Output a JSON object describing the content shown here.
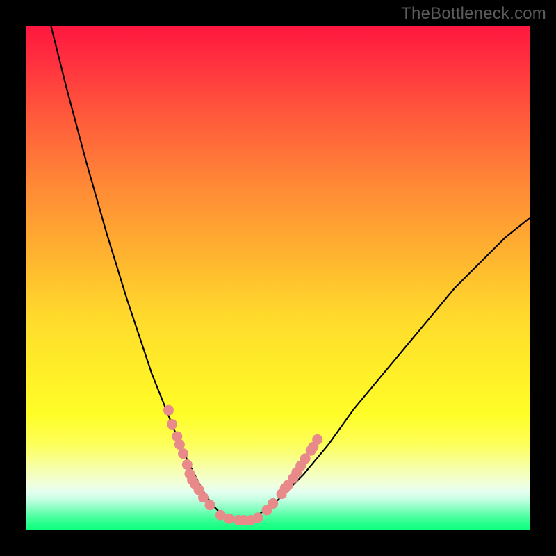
{
  "watermark": "TheBottleneck.com",
  "colors": {
    "background": "#000000",
    "curve_stroke": "#000000",
    "marker_fill": "#e88a8a",
    "gradient_top": "#ff173f",
    "gradient_bottom": "#0dff7c"
  },
  "chart_data": {
    "type": "line",
    "title": "",
    "xlabel": "",
    "ylabel": "",
    "xlim": [
      0,
      100
    ],
    "ylim": [
      0,
      100
    ],
    "series": [
      {
        "name": "bottleneck-curve",
        "x": [
          5,
          8,
          12,
          16,
          20,
          23,
          25,
          27,
          29,
          31,
          33,
          35,
          37,
          38.5,
          40,
          42,
          44,
          46,
          50,
          55,
          60,
          65,
          70,
          75,
          80,
          85,
          90,
          95,
          100
        ],
        "y": [
          100,
          88,
          73,
          59,
          46,
          37,
          31,
          26,
          21,
          16,
          12,
          8,
          5,
          3.5,
          2.5,
          2,
          2,
          3,
          6,
          11,
          17,
          24,
          30,
          36,
          42,
          48,
          53,
          58,
          62
        ]
      }
    ],
    "markers": [
      {
        "x": 28.3,
        "y": 23.8
      },
      {
        "x": 29.0,
        "y": 21.0
      },
      {
        "x": 30.0,
        "y": 18.6
      },
      {
        "x": 30.5,
        "y": 17.0
      },
      {
        "x": 31.2,
        "y": 15.2
      },
      {
        "x": 32.0,
        "y": 13.0
      },
      {
        "x": 32.5,
        "y": 11.2
      },
      {
        "x": 33.0,
        "y": 10.0
      },
      {
        "x": 33.5,
        "y": 9.2
      },
      {
        "x": 34.3,
        "y": 8.0
      },
      {
        "x": 35.2,
        "y": 6.5
      },
      {
        "x": 36.5,
        "y": 5.0
      },
      {
        "x": 38.6,
        "y": 3.0
      },
      {
        "x": 40.3,
        "y": 2.3
      },
      {
        "x": 42.2,
        "y": 2.0
      },
      {
        "x": 43.2,
        "y": 2.0
      },
      {
        "x": 44.6,
        "y": 2.0
      },
      {
        "x": 46.0,
        "y": 2.5
      },
      {
        "x": 47.8,
        "y": 4.0
      },
      {
        "x": 49.0,
        "y": 5.3
      },
      {
        "x": 50.7,
        "y": 7.2
      },
      {
        "x": 51.4,
        "y": 8.3
      },
      {
        "x": 52.0,
        "y": 9.0
      },
      {
        "x": 53.0,
        "y": 10.3
      },
      {
        "x": 53.7,
        "y": 11.5
      },
      {
        "x": 54.5,
        "y": 12.8
      },
      {
        "x": 55.4,
        "y": 14.2
      },
      {
        "x": 56.5,
        "y": 15.8
      },
      {
        "x": 57.0,
        "y": 16.5
      },
      {
        "x": 57.8,
        "y": 18.0
      }
    ],
    "marker_radius_px": 7.5
  }
}
